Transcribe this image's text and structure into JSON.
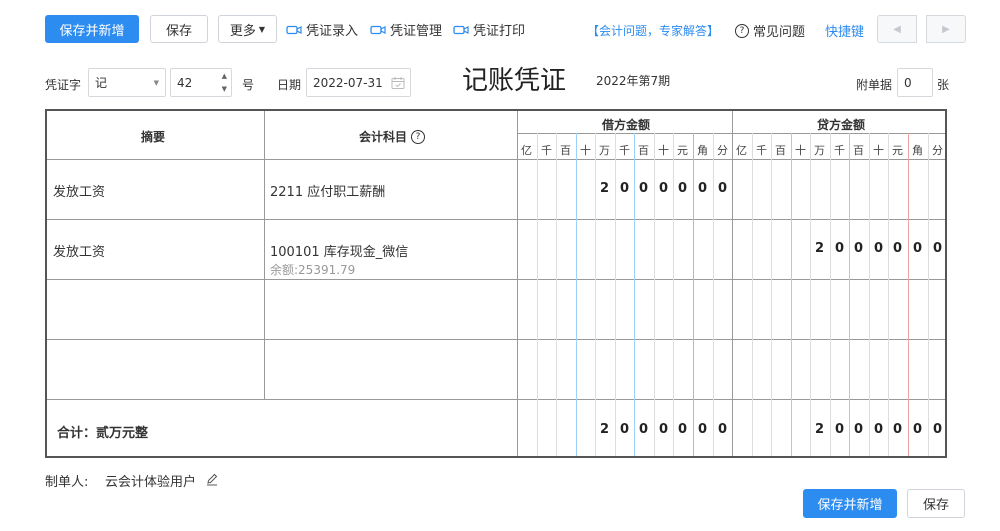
{
  "toolbar": {
    "save_new_label": "保存并新增",
    "save_label": "保存",
    "more_label": "更多",
    "entry_label": "凭证录入",
    "manage_label": "凭证管理",
    "print_label": "凭证打印",
    "expert_label": "【会计问题，专家解答】",
    "faq_label": "常见问题",
    "shortcut_label": "快捷键"
  },
  "header": {
    "voucher_word_label": "凭证字",
    "voucher_word_value": "记",
    "voucher_number": "42",
    "number_unit": "号",
    "date_label": "日期",
    "date_value": "2022-07-31",
    "title": "记账凭证",
    "period": "2022年第7期",
    "attachment_label": "附单据",
    "attachment_count": "0",
    "attachment_unit": "张"
  },
  "table": {
    "col_summary": "摘要",
    "col_account": "会计科目",
    "col_debit": "借方金额",
    "col_credit": "贷方金额",
    "units": [
      "亿",
      "千",
      "百",
      "十",
      "万",
      "千",
      "百",
      "十",
      "元",
      "角",
      "分"
    ],
    "rows": [
      {
        "summary": "发放工资",
        "account": "2211 应付职工薪酬",
        "balance": "",
        "debit": "2000000",
        "credit": ""
      },
      {
        "summary": "发放工资",
        "account": "100101 库存现金_微信",
        "balance": "余额:25391.79",
        "debit": "",
        "credit": "2000000"
      },
      {
        "summary": "",
        "account": "",
        "balance": "",
        "debit": "",
        "credit": ""
      },
      {
        "summary": "",
        "account": "",
        "balance": "",
        "debit": "",
        "credit": ""
      }
    ],
    "total_label": "合计：贰万元整",
    "total_debit": "2000000",
    "total_credit": "2000000"
  },
  "footer": {
    "maker_label": "制单人:",
    "maker_name": "云会计体验用户",
    "save_new_label": "保存并新增",
    "save_label": "保存"
  },
  "colors": {
    "accent": "#2d8cf0",
    "border": "#555555",
    "blue_line": "#9fd0f5",
    "red_line": "#f0a3a3"
  }
}
